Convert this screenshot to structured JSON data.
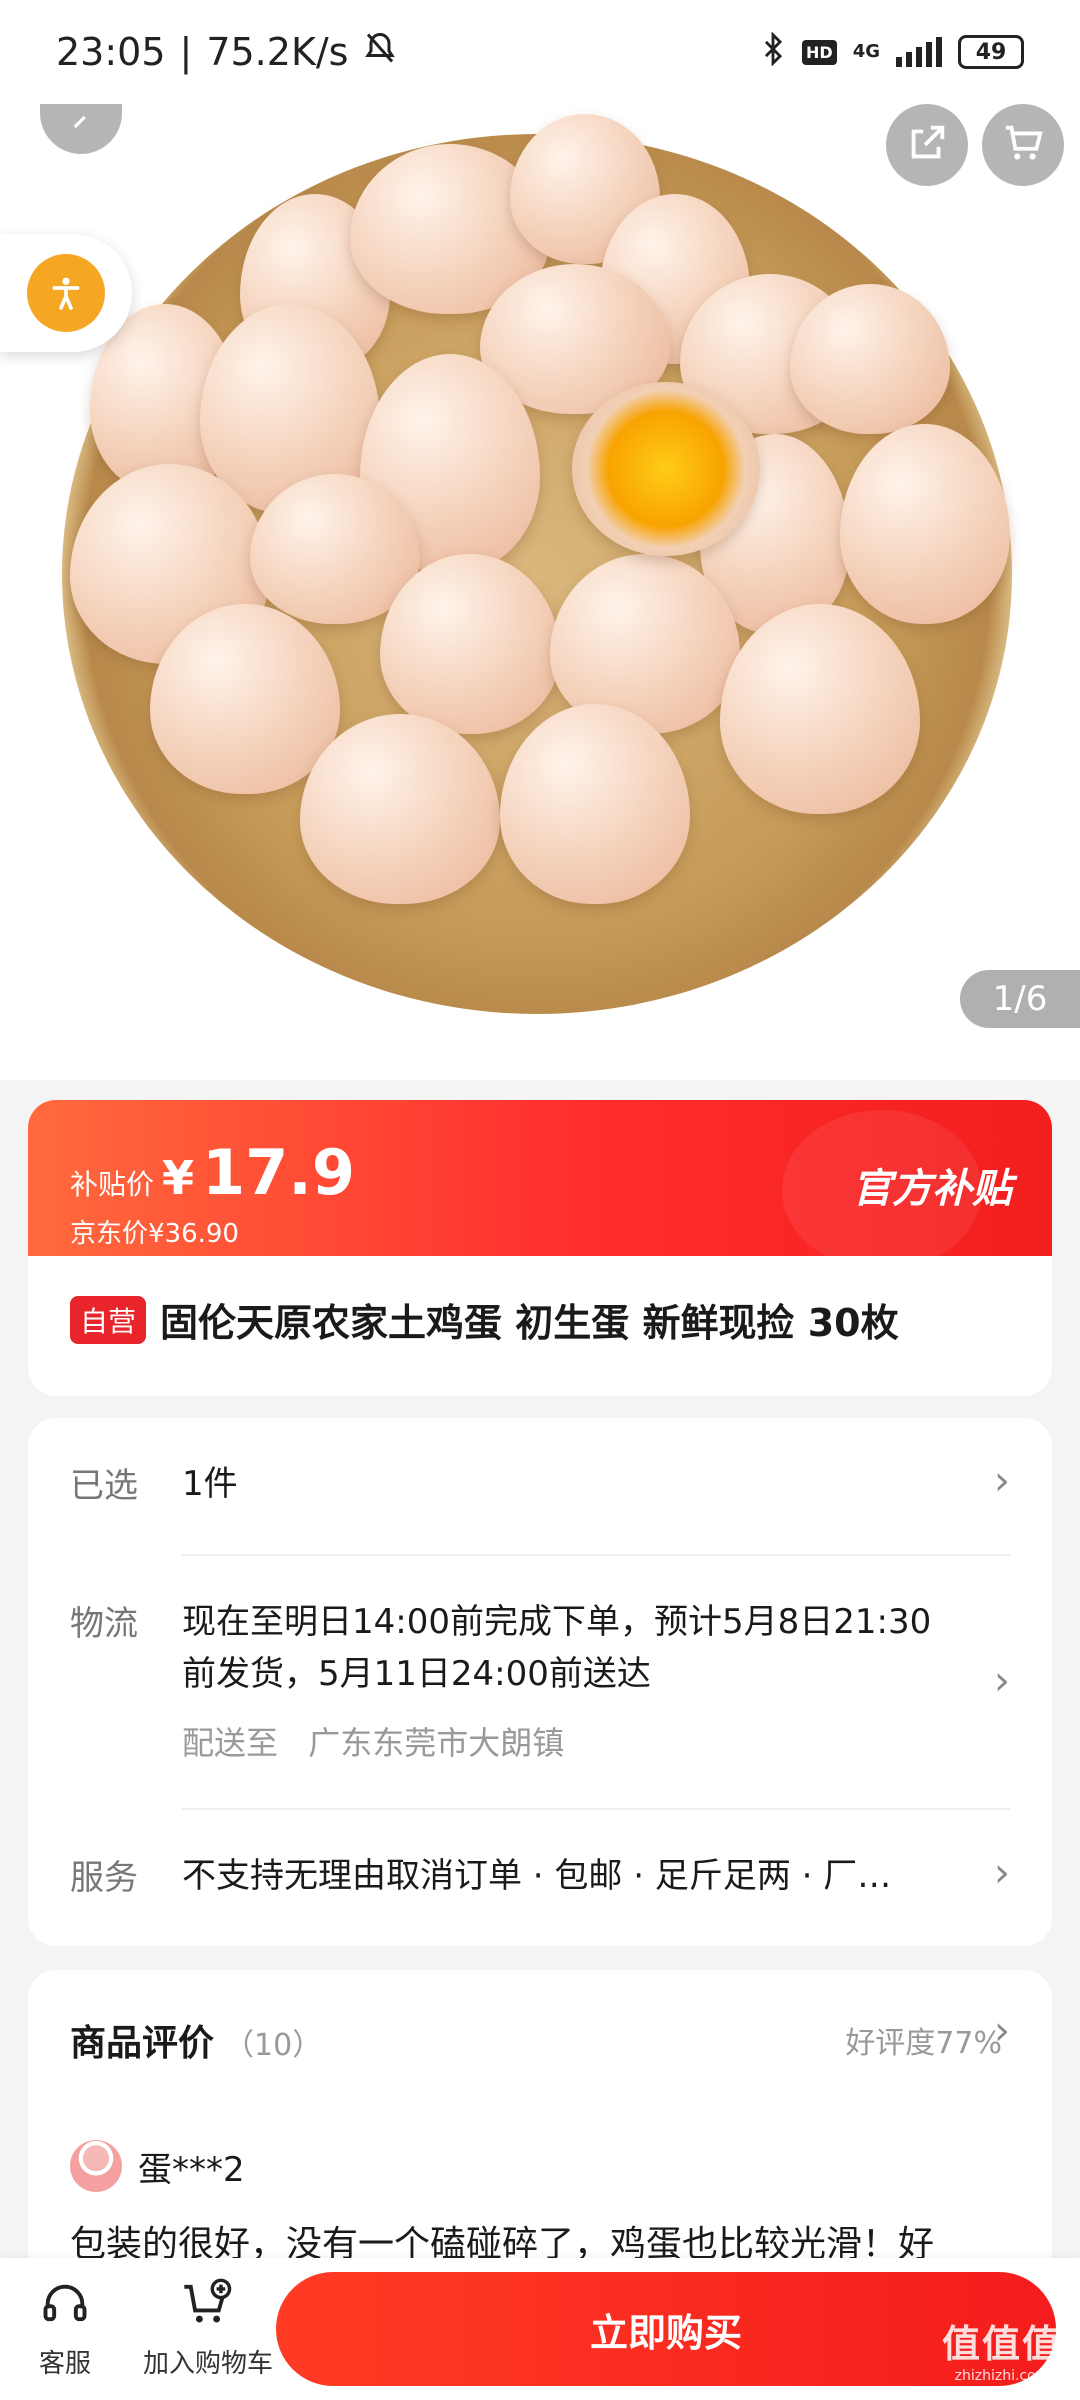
{
  "status_bar": {
    "time": "23:05",
    "speed": "75.2K/s",
    "network": "4G",
    "hd": "HD",
    "battery": "49"
  },
  "gallery": {
    "page_indicator": "1/6",
    "icons": {
      "back": "back-icon",
      "share": "share-icon",
      "cart": "cart-icon",
      "accessibility": "accessibility-icon"
    }
  },
  "price": {
    "subsidy_label": "补贴价",
    "currency": "¥",
    "subsidy_price": "17.9",
    "jd_price_text": "京东价¥36.90",
    "official_badge": "官方补贴"
  },
  "product": {
    "self_tag": "自营",
    "title": "固伦天原农家土鸡蛋 初生蛋  新鲜现捡 30枚"
  },
  "info": {
    "selected_key": "已选",
    "selected_value": "1件",
    "logistics_key": "物流",
    "logistics_line1": "现在至明日14:00前完成下单，预计5月8日21:30",
    "logistics_line2": "前发货，5月11日24:00前送达",
    "ship_to_label": "配送至",
    "ship_to_value": "广东东莞市大朗镇",
    "service_key": "服务",
    "service_value": "不支持无理由取消订单 · 包邮 · 足斤足两 · 厂…"
  },
  "reviews": {
    "title": "商品评价",
    "count": "（10）",
    "rating": "好评度77%",
    "reviewer": "蛋***2",
    "text": "包装的很好，没有一个磕碰碎了，鸡蛋也比较光滑！好"
  },
  "bottom_bar": {
    "service_label": "客服",
    "add_cart_label": "加入购物车",
    "buy_label": "立即购买",
    "watermark_main": "值值值",
    "watermark_sub": "zhizhizhi.com"
  },
  "colors": {
    "accent_red": "#f41c1c",
    "accent_orange": "#ff6a3d",
    "a11y_orange": "#f5a623"
  }
}
